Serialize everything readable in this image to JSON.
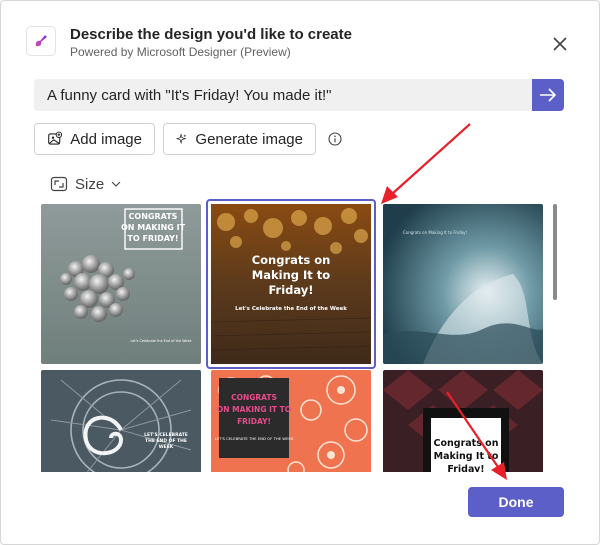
{
  "header": {
    "title": "Describe the design you'd like to create",
    "subtitle": "Powered by Microsoft Designer (Preview)"
  },
  "prompt": {
    "value": "A funny card with \"It's Friday! You made it!\""
  },
  "actions": {
    "add_image": "Add image",
    "generate_image": "Generate image",
    "size_label": "Size"
  },
  "designs": [
    {
      "id": "design-1",
      "lines": [
        "CONGRATS",
        "ON MAKING IT",
        "TO FRIDAY!"
      ],
      "caption": "Let's Celebrate the End of the Week",
      "selected": false
    },
    {
      "id": "design-2",
      "lines": [
        "Congrats on",
        "Making It to",
        "Friday!"
      ],
      "caption": "Let's Celebrate the End of the Week",
      "selected": true
    },
    {
      "id": "design-3",
      "lines": [
        "Congrats on Making It to Friday!"
      ],
      "caption": "",
      "selected": false
    },
    {
      "id": "design-4",
      "lines": [
        "LET'S CELEBRATE",
        "THE END OF THE",
        "WEEK"
      ],
      "caption": "",
      "selected": false
    },
    {
      "id": "design-5",
      "lines": [
        "CONGRATS",
        "ON MAKING IT TO",
        "FRIDAY!"
      ],
      "caption": "LET'S CELEBRATE THE END OF THE WEEK",
      "selected": false
    },
    {
      "id": "design-6",
      "lines": [
        "Congrats on",
        "Making It to",
        "Friday!"
      ],
      "caption": "",
      "selected": false
    }
  ],
  "footer": {
    "done_label": "Done"
  },
  "colors": {
    "accent": "#5b5fc7",
    "annotation": "#e8202a"
  }
}
